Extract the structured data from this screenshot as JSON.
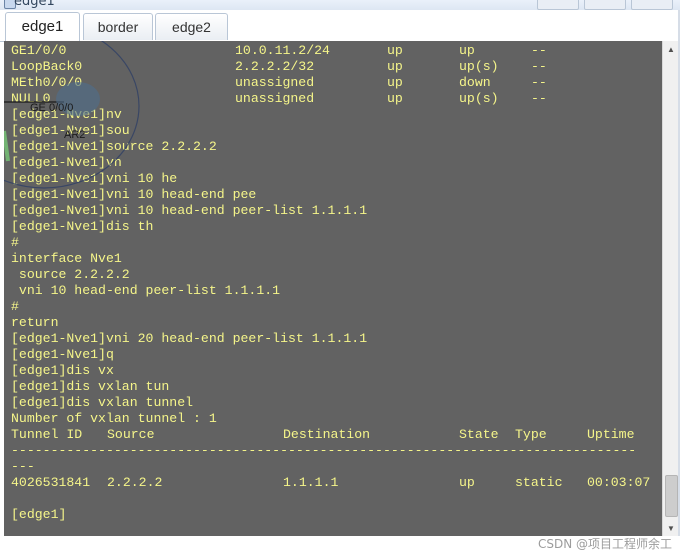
{
  "window": {
    "title": "edge1"
  },
  "tabs": [
    {
      "label": "edge1",
      "active": true
    },
    {
      "label": "border",
      "active": false
    },
    {
      "label": "edge2",
      "active": false
    }
  ],
  "topology_overlay": {
    "labels": [
      "GE 0/0/0",
      "AR2"
    ]
  },
  "terminal": {
    "text_color": "#f5f58a",
    "background": "#626262",
    "interface_rows": [
      [
        "GE1/0/0",
        "10.0.11.2/24",
        "up",
        "up",
        "--"
      ],
      [
        "LoopBack0",
        "2.2.2.2/32",
        "up",
        "up(s)",
        "--"
      ],
      [
        "MEth0/0/0",
        "unassigned",
        "up",
        "down",
        "--"
      ],
      [
        "NULL0",
        "unassigned",
        "up",
        "up(s)",
        "--"
      ]
    ],
    "lines": [
      "[edge1-Nve1]nv",
      "[edge1-Nve1]sou",
      "[edge1-Nve1]source 2.2.2.2",
      "[edge1-Nve1]vn",
      "[edge1-Nve1]vni 10 he",
      "[edge1-Nve1]vni 10 head-end pee",
      "[edge1-Nve1]vni 10 head-end peer-list 1.1.1.1",
      "[edge1-Nve1]dis th",
      "#",
      "interface Nve1",
      " source 2.2.2.2",
      " vni 10 head-end peer-list 1.1.1.1",
      "#",
      "return",
      "[edge1-Nve1]vni 20 head-end peer-list 1.1.1.1",
      "[edge1-Nve1]q",
      "[edge1]dis vx",
      "[edge1]dis vxlan tun",
      "[edge1]dis vxlan tunnel",
      "Number of vxlan tunnel : 1"
    ],
    "tunnel_headers": [
      "Tunnel ID",
      "Source",
      "Destination",
      "State",
      "Type",
      "Uptime"
    ],
    "separator": "-------------------------------------------------------------------------------",
    "separator_cont": "---",
    "tunnel_rows": [
      [
        "4026531841",
        "2.2.2.2",
        "1.1.1.1",
        "up",
        "static",
        "00:03:07"
      ]
    ],
    "blank": "",
    "final_prompt": "[edge1]"
  },
  "watermark": "CSDN @项目工程师余工"
}
